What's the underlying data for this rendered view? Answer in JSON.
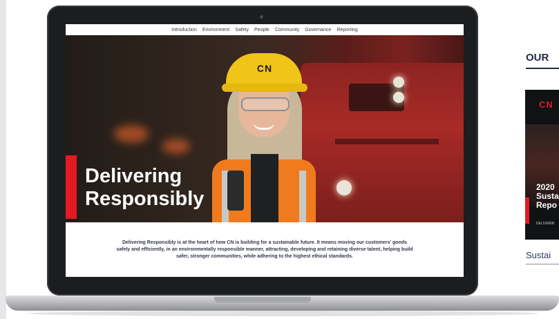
{
  "nav": {
    "items": [
      "Introduction",
      "Environment",
      "Safety",
      "People",
      "Community",
      "Governance",
      "Reporting"
    ]
  },
  "hero": {
    "title_line1": "Delivering",
    "title_line2": "Responsibly",
    "helmet_logo": "CN"
  },
  "intro": {
    "text": "Delivering Responsibly is at the heart of how CN is building for a sustainable future. It means moving our customers' goods safely and efficiently, in an environmentally responsible manner, attracting, developing and retaining diverse talent, helping build safer, stronger communities, while adhering to the highest ethical standards."
  },
  "side": {
    "heading": "OUR",
    "report_logo": "CN",
    "report_title_line1": "2020",
    "report_title_line2": "Susta",
    "report_title_line3": "Repo",
    "report_sub": "DELIVERIN",
    "link_text": "Sustai"
  },
  "colors": {
    "accent_red": "#e31a22",
    "navy": "#1f2a44",
    "helmet_yellow": "#f0c418",
    "vest_orange": "#f07b1e"
  }
}
